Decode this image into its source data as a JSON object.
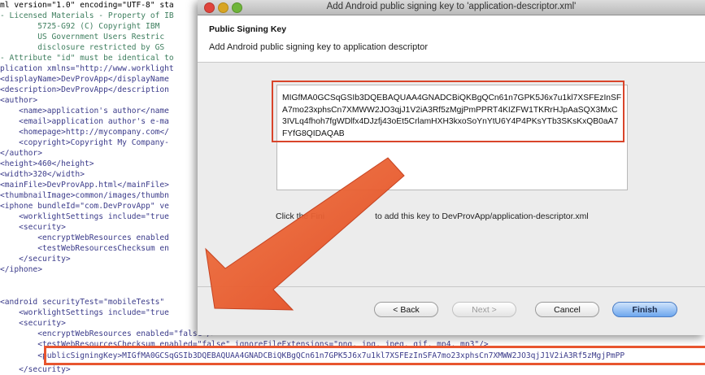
{
  "dialog": {
    "window_title": "Add Android public signing key to 'application-descriptor.xml'",
    "header_title": "Public Signing Key",
    "header_description": "Add Android public signing key to application descriptor",
    "public_key": "MIGfMA0GCSqGSIb3DQEBAQUAA4GNADCBiQKBgQCn61n7GPK5J6x7u1kl7XSFEzInSFA7mo23xphsCn7XMWW2JO3qjJ1V2iA3Rf5zMgjPmPPRT4KIZFW1TKRrHJpAaSQX3MxC3IVLq4fhoh7fgWDlfx4DJzfj43oEt5CrlamHXH3kxoSoYnYtU6Y4P4PKsYTb3SKsKxQB0aA7FYfG8QIDAQAB",
    "instruction_prefix": "Click the Fini",
    "instruction_suffix": "to add this key to DevProvApp/application-descriptor.xml",
    "buttons": {
      "back": "< Back",
      "next": "Next >",
      "cancel": "Cancel",
      "finish": "Finish"
    }
  },
  "editor_lines": [
    {
      "key": "l01",
      "text": "ml version=\"1.0\" encoding=\"UTF-8\" sta"
    },
    {
      "key": "l02",
      "text": "- Licensed Materials - Property of IB"
    },
    {
      "key": "l03",
      "text": "        5725-G92 (C) Copyright IBM"
    },
    {
      "key": "l04",
      "text": "        US Government Users Restric"
    },
    {
      "key": "l05",
      "text": "        disclosure restricted by GS"
    },
    {
      "key": "l06",
      "text": "- Attribute \"id\" must be identical to"
    },
    {
      "key": "l07",
      "text": "plication xmlns=\"http://www.worklight"
    },
    {
      "key": "l08",
      "text": "<displayName>DevProvApp</displayName"
    },
    {
      "key": "l09",
      "text": "<description>DevProvApp</description"
    },
    {
      "key": "l10",
      "text": "<author>"
    },
    {
      "key": "l11",
      "text": "    <name>application's author</name"
    },
    {
      "key": "l12",
      "text": "    <email>application author's e-ma"
    },
    {
      "key": "l13",
      "text": "    <homepage>http://mycompany.com</"
    },
    {
      "key": "l14",
      "text": "    <copyright>Copyright My Company-"
    },
    {
      "key": "l15",
      "text": "</author>"
    },
    {
      "key": "l16",
      "text": "<height>460</height>"
    },
    {
      "key": "l17",
      "text": "<width>320</width>"
    },
    {
      "key": "l18",
      "text": "<mainFile>DevProvApp.html</mainFile>"
    },
    {
      "key": "l19",
      "text": "<thumbnailImage>common/images/thumbn"
    },
    {
      "key": "l20",
      "text": "<iphone bundleId=\"com.DevProvApp\" ve"
    },
    {
      "key": "l21",
      "text": "    <worklightSettings include=\"true"
    },
    {
      "key": "l22",
      "text": "    <security>"
    },
    {
      "key": "l23",
      "text": "        <encryptWebResources enabled"
    },
    {
      "key": "l24",
      "text": "        <testWebResourcesChecksum en"
    },
    {
      "key": "l25",
      "text": "    </security>"
    },
    {
      "key": "l26",
      "text": "</iphone>"
    },
    {
      "key": "l27",
      "text": "<android securityTest=\"mobileTests\""
    },
    {
      "key": "l28",
      "text": "    <worklightSettings include=\"true"
    },
    {
      "key": "l29",
      "text": "    <security>"
    },
    {
      "key": "l30",
      "text": "        <encryptWebResources enabled=\"false\"/>"
    },
    {
      "key": "l31",
      "text": "        <testWebResourcesChecksum enabled=\"false\" ignoreFileExtensions=\"png, jpg, jpeg, gif, mp4, mp3\"/>"
    },
    {
      "key": "l32",
      "text": "        <publicSigningKey>MIGfMA0GCSqGSIb3DQEBAQUAA4GNADCBiQKBgQCn61n7GPK5J6x7u1kl7XSFEzInSFA7mo23xphsCn7XMWW2JO3qjJ1V2iA3Rf5zMgjPmPP"
    },
    {
      "key": "l33",
      "text": "    </security>"
    }
  ],
  "colors": {
    "highlight": "#d9452b",
    "arrow": "#e8552f",
    "finish_button": "#6ea7ee",
    "close_button": "#e0443c",
    "minimize_button": "#d8a523",
    "zoom_button": "#6fb53a"
  }
}
